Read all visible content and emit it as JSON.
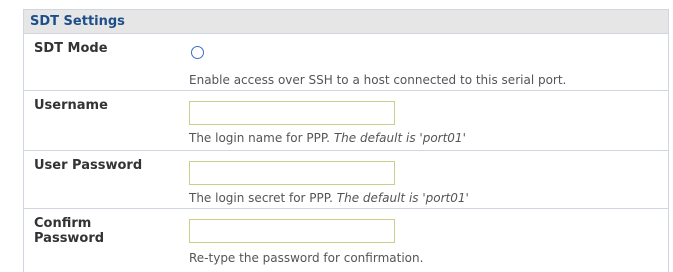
{
  "section": {
    "title": "SDT Settings"
  },
  "rows": [
    {
      "label": "SDT Mode",
      "help": "Enable access over SSH to a host connected to this serial port."
    },
    {
      "label": "Username",
      "help": "The login name for PPP.",
      "help_default": "The default is 'port01'",
      "value": ""
    },
    {
      "label": "User Password",
      "help": "The login secret for PPP.",
      "help_default": "The default is 'port01'",
      "value": ""
    },
    {
      "label_line1": "Confirm",
      "label_line2": "Password",
      "help": "Re-type the password for confirmation.",
      "value": ""
    }
  ],
  "colors": {
    "header_text": "#1c4f8a",
    "header_bg": "#e6e6e6",
    "row_border": "#cfd6e0",
    "input_border": "#c8d08c",
    "radio_border": "#3e6ec5"
  }
}
